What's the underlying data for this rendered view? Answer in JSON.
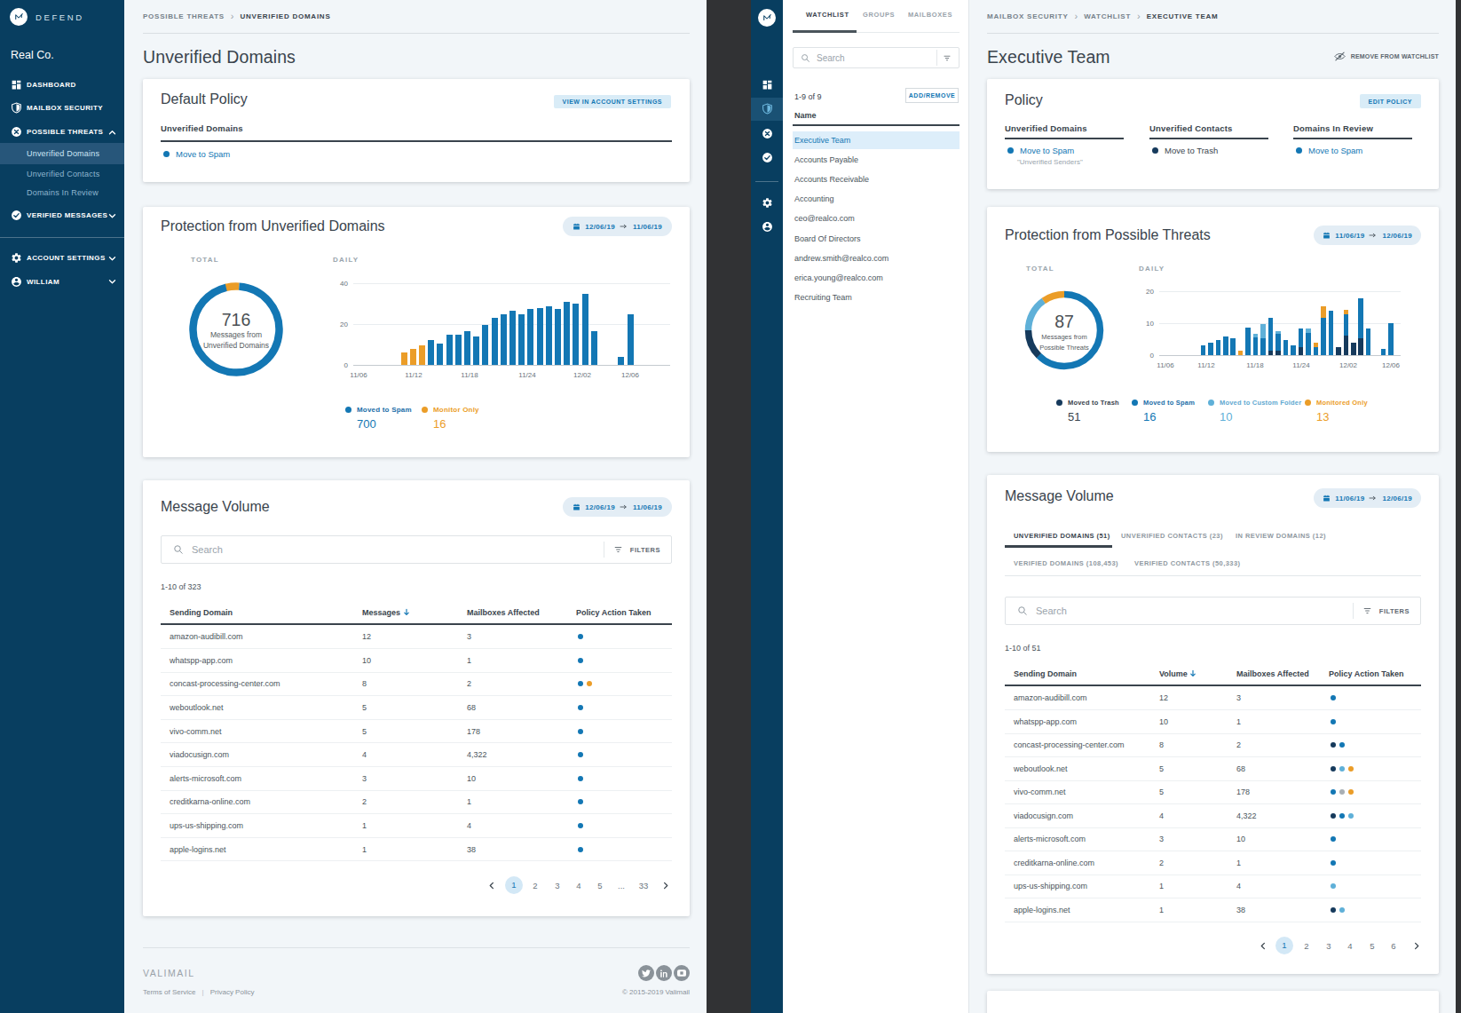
{
  "colors": {
    "sidebar_navy": "#083e60",
    "accent_blue": "#1377b4",
    "light_blue": "#5fb0d8",
    "dark_navy": "#163a5c",
    "orange": "#eb9d28",
    "gray_dot": "#a9afb4",
    "page_bg": "#f2f6f9",
    "gap_dark": "#313234"
  },
  "left_app": {
    "sidebar": {
      "brand": "DEFEND",
      "org": "Real Co.",
      "items": [
        {
          "label": "DASHBOARD",
          "icon": "dashboard"
        },
        {
          "label": "MAILBOX SECURITY",
          "icon": "shield"
        },
        {
          "label": "POSSIBLE THREATS",
          "icon": "threat",
          "caret": "up"
        },
        {
          "label": "Unverified Domains",
          "sub": true,
          "active": true
        },
        {
          "label": "Unverified Contacts",
          "sub": true
        },
        {
          "label": "Domains In Review",
          "sub": true
        },
        {
          "label": "VERIFIED MESSAGES",
          "icon": "check",
          "caret": "down"
        },
        {
          "divider": true
        },
        {
          "label": "ACCOUNT SETTINGS",
          "icon": "gear",
          "caret": "down"
        },
        {
          "label": "WILLIAM",
          "icon": "person",
          "caret": "down"
        }
      ]
    },
    "breadcrumb": [
      "POSSIBLE THREATS",
      "UNVERIFIED DOMAINS"
    ],
    "page_title": "Unverified Domains",
    "default_policy": {
      "title": "Default Policy",
      "button": "VIEW IN ACCOUNT SETTINGS",
      "section": "Unverified Domains",
      "action": "Move to Spam"
    },
    "protection": {
      "title": "Protection from Unverified Domains",
      "date_start": "12/06/19",
      "date_end": "11/06/19",
      "total_label": "TOTAL",
      "daily_label": "DAILY",
      "donut_value": "716",
      "donut_line1": "Messages from",
      "donut_line2": "Unverified Domains",
      "legend": [
        {
          "label": "Moved to Spam",
          "value": "700",
          "color": "blue"
        },
        {
          "label": "Monitor Only",
          "value": "16",
          "color": "orange"
        }
      ]
    },
    "message_volume": {
      "title": "Message Volume",
      "date_start": "12/06/19",
      "date_end": "11/06/19",
      "search_placeholder": "Search",
      "filters_label": "FILTERS",
      "count": "1-10 of 323",
      "columns": [
        "Sending Domain",
        "Messages",
        "Mailboxes Affected",
        "Policy Action Taken"
      ],
      "sorted_column": "Messages",
      "rows": [
        {
          "domain": "amazon-audibill.com",
          "messages": "12",
          "mailboxes": "3",
          "dots": [
            "blue"
          ]
        },
        {
          "domain": "whatspp-app.com",
          "messages": "10",
          "mailboxes": "1",
          "dots": [
            "blue"
          ]
        },
        {
          "domain": "concast-processing-center.com",
          "messages": "8",
          "mailboxes": "2",
          "dots": [
            "blue",
            "orange"
          ]
        },
        {
          "domain": "weboutlook.net",
          "messages": "5",
          "mailboxes": "68",
          "dots": [
            "blue"
          ]
        },
        {
          "domain": "vivo-comm.net",
          "messages": "5",
          "mailboxes": "178",
          "dots": [
            "blue"
          ]
        },
        {
          "domain": "viadocusign.com",
          "messages": "4",
          "mailboxes": "4,322",
          "dots": [
            "blue"
          ]
        },
        {
          "domain": "alerts-microsoft.com",
          "messages": "3",
          "mailboxes": "10",
          "dots": [
            "blue"
          ]
        },
        {
          "domain": "creditkarna-online.com",
          "messages": "2",
          "mailboxes": "1",
          "dots": [
            "blue"
          ]
        },
        {
          "domain": "ups-us-shipping.com",
          "messages": "1",
          "mailboxes": "4",
          "dots": [
            "blue"
          ]
        },
        {
          "domain": "apple-logins.net",
          "messages": "1",
          "mailboxes": "38",
          "dots": [
            "blue"
          ]
        }
      ],
      "pagination": [
        "1",
        "2",
        "3",
        "4",
        "5",
        "...",
        "33"
      ],
      "active_page": "1"
    },
    "footer": {
      "brand": "VALIMAIL",
      "link1": "Terms of Service",
      "link2": "Privacy Policy",
      "copyright": "© 2015-2019 Valimail",
      "social": [
        "twitter",
        "linkedin",
        "youtube"
      ]
    }
  },
  "right_app": {
    "rail": {
      "icons": [
        "dashboard",
        "shield",
        "threat",
        "check",
        "gear",
        "person"
      ],
      "active": "shield"
    },
    "watchlist_panel": {
      "tabs": [
        "WATCHLIST",
        "GROUPS",
        "MAILBOXES"
      ],
      "active_tab": "WATCHLIST",
      "search_placeholder": "Search",
      "count": "1-9 of 9",
      "add_remove": "ADD/REMOVE",
      "name_header": "Name",
      "items": [
        "Executive Team",
        "Accounts Payable",
        "Accounts Receivable",
        "Accounting",
        "ceo@realco.com",
        "Board Of Directors",
        "andrew.smith@realco.com",
        "erica.young@realco.com",
        "Recruiting Team"
      ],
      "active_item": "Executive Team"
    },
    "breadcrumb": [
      "MAILBOX SECURITY",
      "WATCHLIST",
      "EXECUTIVE TEAM"
    ],
    "page_title": "Executive Team",
    "remove_button": "REMOVE FROM WATCHLIST",
    "policy": {
      "title": "Policy",
      "button": "EDIT POLICY",
      "columns": [
        {
          "heading": "Unverified Domains",
          "action": "Move to Spam",
          "caption": "\"Unverified Senders\"",
          "color": "blue"
        },
        {
          "heading": "Unverified Contacts",
          "action": "Move to Trash",
          "color": "navy"
        },
        {
          "heading": "Domains In Review",
          "action": "Move to Spam",
          "color": "blue"
        }
      ]
    },
    "protection": {
      "title": "Protection from Possible Threats",
      "date_start": "11/06/19",
      "date_end": "12/06/19",
      "total_label": "TOTAL",
      "daily_label": "DAILY",
      "donut_value": "87",
      "donut_line1": "Messages from",
      "donut_line2": "Possible Threats",
      "legend": [
        {
          "label": "Moved to Trash",
          "value": "51",
          "color": "navy"
        },
        {
          "label": "Moved to Spam",
          "value": "16",
          "color": "blue"
        },
        {
          "label": "Moved to Custom Folder",
          "value": "10",
          "color": "light"
        },
        {
          "label": "Monitored Only",
          "value": "13",
          "color": "orange"
        }
      ]
    },
    "message_volume": {
      "title": "Message Volume",
      "date_start": "11/06/19",
      "date_end": "12/06/19",
      "tabs_row1": [
        "UNVERIFIED DOMAINS (51)",
        "UNVERIFIED CONTACTS (23)",
        "IN REVIEW DOMAINS (12)"
      ],
      "tabs_row2": [
        "VERIFIED DOMAINS (108,453)",
        "VERIFIED CONTACTS (50,333)"
      ],
      "active_tab": "UNVERIFIED DOMAINS (51)",
      "search_placeholder": "Search",
      "filters_label": "FILTERS",
      "count": "1-10 of 51",
      "columns": [
        "Sending Domain",
        "Volume",
        "Mailboxes Affected",
        "Policy Action Taken"
      ],
      "sorted_column": "Volume",
      "rows": [
        {
          "domain": "amazon-audibill.com",
          "volume": "12",
          "mailboxes": "3",
          "dots": [
            "blue"
          ]
        },
        {
          "domain": "whatspp-app.com",
          "volume": "10",
          "mailboxes": "1",
          "dots": [
            "blue"
          ]
        },
        {
          "domain": "concast-processing-center.com",
          "volume": "8",
          "mailboxes": "2",
          "dots": [
            "navy",
            "blue"
          ]
        },
        {
          "domain": "weboutlook.net",
          "volume": "5",
          "mailboxes": "68",
          "dots": [
            "navy",
            "light",
            "orange"
          ]
        },
        {
          "domain": "vivo-comm.net",
          "volume": "5",
          "mailboxes": "178",
          "dots": [
            "blue",
            "gray",
            "orange"
          ]
        },
        {
          "domain": "viadocusign.com",
          "volume": "4",
          "mailboxes": "4,322",
          "dots": [
            "navy",
            "blue",
            "light"
          ]
        },
        {
          "domain": "alerts-microsoft.com",
          "volume": "3",
          "mailboxes": "10",
          "dots": [
            "blue"
          ]
        },
        {
          "domain": "creditkarna-online.com",
          "volume": "2",
          "mailboxes": "1",
          "dots": [
            "blue"
          ]
        },
        {
          "domain": "ups-us-shipping.com",
          "volume": "1",
          "mailboxes": "4",
          "dots": [
            "light"
          ]
        },
        {
          "domain": "apple-logins.net",
          "volume": "1",
          "mailboxes": "38",
          "dots": [
            "navy",
            "light"
          ]
        }
      ],
      "pagination": [
        "1",
        "2",
        "3",
        "4",
        "5",
        "6"
      ],
      "active_page": "1"
    }
  },
  "chart_data": [
    {
      "id": "left_daily",
      "type": "bar",
      "title": "Protection from Unverified Domains — Daily",
      "xlabel": "",
      "ylabel": "",
      "ylim": [
        0,
        40
      ],
      "yticks": [
        0,
        20,
        40
      ],
      "tick_labels": [
        "11/06",
        "11/12",
        "11/18",
        "11/24",
        "12/02",
        "12/06"
      ],
      "tick_slots": [
        0,
        6,
        12,
        18,
        26,
        30
      ],
      "slots": 31,
      "legend_position": "bottom",
      "grid": true,
      "bars": [
        {
          "slot": 5,
          "o": 6
        },
        {
          "slot": 6,
          "o": 8
        },
        {
          "slot": 7,
          "o": 9.5
        },
        {
          "slot": 8,
          "b": 12
        },
        {
          "slot": 9,
          "b": 10.5
        },
        {
          "slot": 10,
          "b": 15
        },
        {
          "slot": 11,
          "b": 15
        },
        {
          "slot": 12,
          "b": 16.5
        },
        {
          "slot": 13,
          "b": 14
        },
        {
          "slot": 14,
          "b": 19.5
        },
        {
          "slot": 15,
          "b": 23
        },
        {
          "slot": 16,
          "b": 25
        },
        {
          "slot": 17,
          "b": 26.5
        },
        {
          "slot": 18,
          "b": 25
        },
        {
          "slot": 19,
          "b": 27.5
        },
        {
          "slot": 20,
          "b": 28
        },
        {
          "slot": 21,
          "b": 28.5
        },
        {
          "slot": 22,
          "b": 27.5
        },
        {
          "slot": 23,
          "b": 31
        },
        {
          "slot": 24,
          "b": 30
        },
        {
          "slot": 25,
          "b": 35
        },
        {
          "slot": 26,
          "b": 16.5
        },
        {
          "slot": 29,
          "b": 4
        },
        {
          "slot": 30,
          "b": 25
        }
      ],
      "series_colors": {
        "b": "Moved to Spam",
        "o": "Monitor Only"
      }
    },
    {
      "id": "left_total",
      "type": "pie",
      "title": "Messages from Unverified Domains — Total",
      "total": 716,
      "segments": [
        {
          "label": "Moved to Spam",
          "value": 700,
          "color": "blue"
        },
        {
          "label": "Monitor Only",
          "value": 16,
          "color": "orange"
        }
      ],
      "display_arcs": [
        [
          "orange",
          18,
          -14
        ],
        [
          "blue",
          342,
          4
        ]
      ]
    },
    {
      "id": "right_daily",
      "type": "bar",
      "title": "Protection from Possible Threats — Daily (stacked)",
      "xlabel": "",
      "ylabel": "",
      "ylim": [
        0,
        20
      ],
      "yticks": [
        0,
        10,
        20
      ],
      "tick_labels": [
        "11/06",
        "11/12",
        "11/18",
        "11/24",
        "12/02",
        "12/06"
      ],
      "tick_slots": [
        0,
        6,
        12,
        18,
        26,
        30
      ],
      "slots": 31,
      "legend_position": "bottom",
      "grid": true,
      "bars": [
        {
          "slot": 5,
          "b": 3
        },
        {
          "slot": 6,
          "b": 4
        },
        {
          "slot": 7,
          "b": 4.8
        },
        {
          "slot": 8,
          "b": 5.8
        },
        {
          "slot": 9,
          "b": 5.2
        },
        {
          "slot": 10,
          "o": 1.5
        },
        {
          "slot": 11,
          "b": 8.5
        },
        {
          "slot": 12,
          "b": 5.5,
          "l": 1.2
        },
        {
          "slot": 13,
          "b": 5.4,
          "l": 4.4
        },
        {
          "slot": 14,
          "n": 1.4,
          "b": 10.2
        },
        {
          "slot": 15,
          "n": 1.3,
          "b": 5.3,
          "l": 1
        },
        {
          "slot": 16,
          "b": 4.8
        },
        {
          "slot": 17,
          "b": 3
        },
        {
          "slot": 18,
          "n": 2.6,
          "b": 5.8
        },
        {
          "slot": 19,
          "b": 7,
          "l": 1.4
        },
        {
          "slot": 20,
          "b": 2.5,
          "o": 1.5
        },
        {
          "slot": 21,
          "b": 11.8,
          "o": 3.5
        },
        {
          "slot": 22,
          "b": 14
        },
        {
          "slot": 23,
          "n": 2.5
        },
        {
          "slot": 24,
          "n": 6.2,
          "b": 6.6,
          "o": 1.5
        },
        {
          "slot": 25,
          "n": 4
        },
        {
          "slot": 26,
          "n": 5.4,
          "b": 12.3
        },
        {
          "slot": 27,
          "b": 8.4
        },
        {
          "slot": 29,
          "b": 2
        },
        {
          "slot": 30,
          "b": 10
        }
      ],
      "series_colors": {
        "n": "Moved to Trash",
        "b": "Moved to Spam",
        "l": "Moved to Custom Folder",
        "o": "Monitored Only"
      }
    },
    {
      "id": "right_total",
      "type": "pie",
      "title": "Messages from Possible Threats — Total",
      "total": 87,
      "segments": [
        {
          "label": "Moved to Trash",
          "value": 51,
          "color": "navy"
        },
        {
          "label": "Moved to Spam",
          "value": 16,
          "color": "blue"
        },
        {
          "label": "Moved to Custom Folder",
          "value": 10,
          "color": "light"
        },
        {
          "label": "Monitored Only",
          "value": 13,
          "color": "orange"
        }
      ],
      "display_arcs": [
        [
          "blue",
          225,
          0
        ],
        [
          "navy",
          45,
          225
        ],
        [
          "light",
          55,
          270
        ],
        [
          "orange",
          35,
          325
        ]
      ]
    }
  ]
}
